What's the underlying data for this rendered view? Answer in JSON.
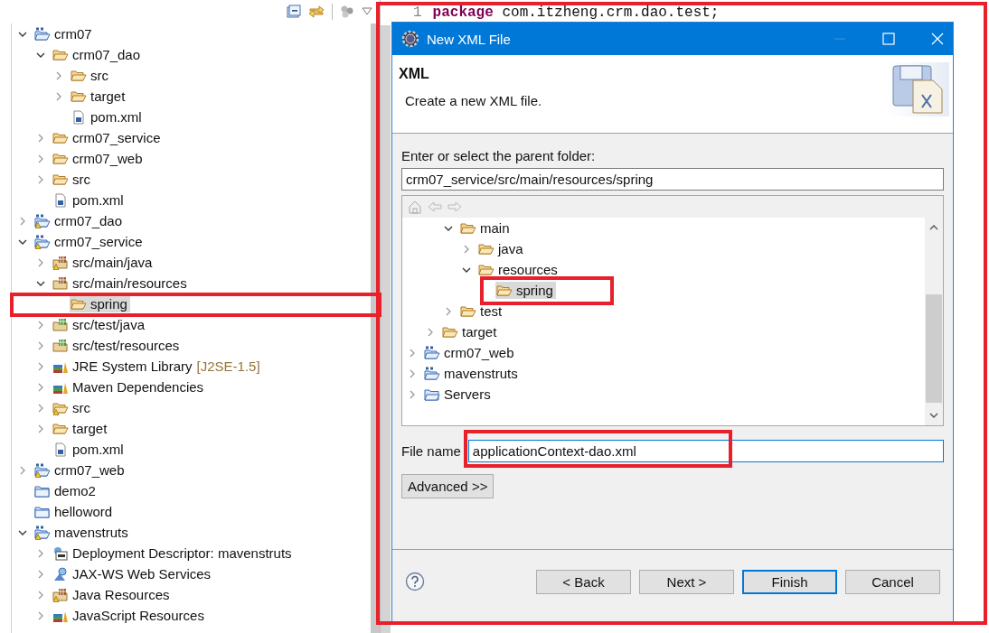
{
  "explorer": {
    "items": [
      {
        "label": "crm07",
        "kind": "project",
        "expanded": true,
        "selected": false,
        "children": [
          {
            "label": "crm07_dao",
            "kind": "folder",
            "expanded": true,
            "selected": false,
            "children": [
              {
                "label": "src",
                "kind": "folder",
                "expanded": false,
                "selected": false
              },
              {
                "label": "target",
                "kind": "folder",
                "expanded": false,
                "selected": false
              },
              {
                "label": "pom.xml",
                "kind": "pom",
                "selected": false
              }
            ]
          },
          {
            "label": "crm07_service",
            "kind": "folder",
            "expanded": false,
            "selected": false
          },
          {
            "label": "crm07_web",
            "kind": "folder",
            "expanded": false,
            "selected": false
          },
          {
            "label": "src",
            "kind": "folder",
            "expanded": false,
            "selected": false
          },
          {
            "label": "pom.xml",
            "kind": "pom",
            "selected": false
          }
        ]
      },
      {
        "label": "crm07_dao",
        "kind": "project-warning",
        "expanded": false,
        "selected": false
      },
      {
        "label": "crm07_service",
        "kind": "project-warning",
        "expanded": true,
        "selected": false,
        "children": [
          {
            "label": "src/main/java",
            "kind": "source-folder-warning",
            "expanded": false,
            "selected": false
          },
          {
            "label": "src/main/resources",
            "kind": "source-folder",
            "expanded": true,
            "selected": false,
            "children": [
              {
                "label": "spring",
                "kind": "folder",
                "selected": true
              }
            ]
          },
          {
            "label": "src/test/java",
            "kind": "test-folder",
            "expanded": false,
            "selected": false
          },
          {
            "label": "src/test/resources",
            "kind": "test-folder",
            "expanded": false,
            "selected": false
          },
          {
            "label": "JRE System Library",
            "decoration": "[J2SE-1.5]",
            "kind": "library",
            "expanded": false,
            "selected": false
          },
          {
            "label": "Maven Dependencies",
            "kind": "library",
            "expanded": false,
            "selected": false
          },
          {
            "label": "src",
            "kind": "folder-warning",
            "expanded": false,
            "selected": false
          },
          {
            "label": "target",
            "kind": "folder",
            "expanded": false,
            "selected": false
          },
          {
            "label": "pom.xml",
            "kind": "pom",
            "selected": false
          }
        ]
      },
      {
        "label": "crm07_web",
        "kind": "project-warning",
        "expanded": false,
        "selected": false
      },
      {
        "label": "demo2",
        "kind": "closed-project",
        "selected": false
      },
      {
        "label": "helloword",
        "kind": "closed-project",
        "selected": false
      },
      {
        "label": "mavenstruts",
        "kind": "project-warning",
        "expanded": true,
        "selected": false,
        "children": [
          {
            "label": "Deployment Descriptor: mavenstruts",
            "kind": "descriptor",
            "expanded": false,
            "selected": false
          },
          {
            "label": "JAX-WS Web Services",
            "kind": "web-services",
            "expanded": false,
            "selected": false
          },
          {
            "label": "Java Resources",
            "kind": "java-resources",
            "expanded": false,
            "selected": false
          },
          {
            "label": "JavaScript Resources",
            "kind": "library",
            "expanded": false,
            "selected": false
          }
        ]
      }
    ]
  },
  "editor": {
    "line_number": "1",
    "code": "**package** com.itzheng.crm.dao.test;"
  },
  "dialog": {
    "title": "New XML File",
    "heading": "XML",
    "description": "Create a new XML file.",
    "folder_label": "Enter or select the parent folder:",
    "folder_value": "crm07_service/src/main/resources/spring",
    "folder_tree": {
      "items": [
        {
          "children": [
            {
              "children": [
                {
                  "label": "main",
                  "kind": "folder",
                  "expanded": true,
                  "selected": false,
                  "children": [
                    {
                      "label": "java",
                      "kind": "folder",
                      "expanded": false,
                      "selected": false
                    },
                    {
                      "label": "resources",
                      "kind": "folder",
                      "expanded": true,
                      "selected": false,
                      "children": [
                        {
                          "label": "spring",
                          "kind": "folder",
                          "selected": true
                        }
                      ]
                    }
                  ]
                },
                {
                  "label": "test",
                  "kind": "folder",
                  "expanded": false,
                  "selected": false
                }
              ]
            },
            {
              "label": "target",
              "kind": "folder",
              "expanded": false,
              "selected": false
            }
          ]
        },
        {
          "label": "crm07_web",
          "kind": "project",
          "expanded": false,
          "selected": false
        },
        {
          "label": "mavenstruts",
          "kind": "project",
          "expanded": false,
          "selected": false
        },
        {
          "label": "Servers",
          "kind": "closed-project",
          "expanded": false,
          "selected": false
        }
      ]
    },
    "file_name_label": "File name",
    "file_name_value": "applicationContext-dao.xml",
    "advanced_button": "Advanced >>",
    "buttons": [
      {
        "label": "< Back",
        "default": false
      },
      {
        "label": "Next >",
        "default": false
      },
      {
        "label": "Finish",
        "default": true
      },
      {
        "label": "Cancel",
        "default": false
      }
    ]
  }
}
